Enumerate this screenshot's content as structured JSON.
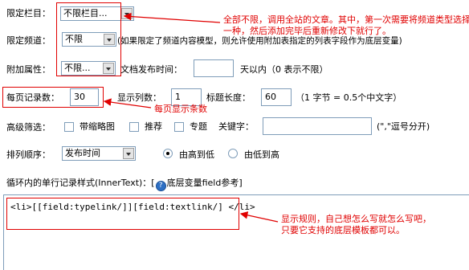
{
  "form": {
    "category": {
      "label": "限定栏目：",
      "value": "不限栏目..."
    },
    "channel": {
      "label": "限定频道：",
      "value": "不限",
      "hint": "(如果限定了频道内容模型，则允许使用附加表指定的列表字段作为底层变量)"
    },
    "attribute": {
      "label": "附加属性：",
      "value": "不限..."
    },
    "publish_time": {
      "label": "文档发布时间：",
      "value": "",
      "unit": "天以内（0 表示不限）"
    },
    "page_size": {
      "label": "每页记录数：",
      "value": "30"
    },
    "columns": {
      "label": "显示列数：",
      "value": "1"
    },
    "title_length": {
      "label": "标题长度：",
      "value": "60",
      "hint": "（1 字节 = 0.5个中文字）"
    },
    "advanced_filter": {
      "label": "高级筛选：",
      "options": [
        "带缩略图",
        "推荐",
        "专题"
      ],
      "keyword_label": "关键字：",
      "keyword_value": "",
      "keyword_hint": "(\",\"逗号分开)"
    },
    "sort": {
      "label": "排列顺序：",
      "value": "发布时间",
      "desc_label": "由高到低",
      "asc_label": "由低到高",
      "selected": "desc"
    },
    "inner_text": {
      "label": "循环内的单行记录样式(InnerText)：[",
      "link_label": "底层变量field参考",
      "suffix": "]",
      "value": "<li>[[field:typelink/]][field:textlink/] </li>"
    }
  },
  "annotations": {
    "note_top": [
      "全部不限，调用全站的文章。其中，第一次需要将频道类型选择",
      "一种，然后添加完毕后重新修改下就行了。"
    ],
    "note_page": "每页显示条数",
    "note_template": [
      "显示规则，自己想怎么写就怎么写吧，",
      "只要它支持的底层模板都可以。"
    ]
  },
  "colors": {
    "annotation": "#e00000",
    "border": "#7f9db9"
  },
  "icons": {
    "help": "help-icon"
  }
}
